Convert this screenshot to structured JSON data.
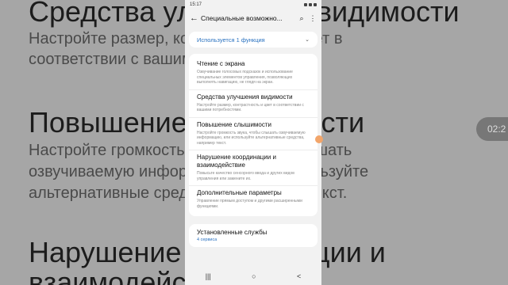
{
  "background": {
    "title1": "Средства улучшения видимости",
    "sub1a": "Настройте размер, контрастность и цвет в",
    "sub1b": "соответствии с вашими потребностями.",
    "title2": "Повышение слышимости",
    "sub2a": "Настройте громкость звука, чтобы слышать",
    "sub2b": "озвучиваемую информацию, или используйте",
    "sub2c": "альтернативные средства, например текст.",
    "title3": "Нарушение координации и",
    "title3b": "взаимодействие",
    "time": "02:2"
  },
  "status": {
    "time": "15:17"
  },
  "appbar": {
    "back_icon": "←",
    "title": "Специальные возможно...",
    "search_icon": "⌕",
    "more_icon": "⋮"
  },
  "usage": {
    "label": "Используется 1 функция",
    "chevron": "⌄"
  },
  "items": [
    {
      "title": "Чтение с экрана",
      "desc": "Озвучивание голосовых подсказок и использование специальных элементов управления, позволяющих выполнять навигацию, не глядя на экран."
    },
    {
      "title": "Средства улучшения видимости",
      "desc": "Настройте размер, контрастность и цвет в соответствии с вашими потребностями."
    },
    {
      "title": "Повышение слышимости",
      "desc": "Настройте громкость звука, чтобы слышать озвучиваемую информацию, или используйте альтернативные средства, например текст."
    },
    {
      "title": "Нарушение координации и взаимодействие",
      "desc": "Повысьте качество сенсорного ввода и других видов управления или замените их."
    },
    {
      "title": "Дополнительные параметры",
      "desc": "Управление прямым доступом и другими расширенными функциями."
    }
  ],
  "services": {
    "title": "Установленные службы",
    "subtitle": "4 сервиса"
  },
  "navbar": {
    "recent_icon": "|||",
    "home_icon": "○",
    "back_icon": "<"
  }
}
